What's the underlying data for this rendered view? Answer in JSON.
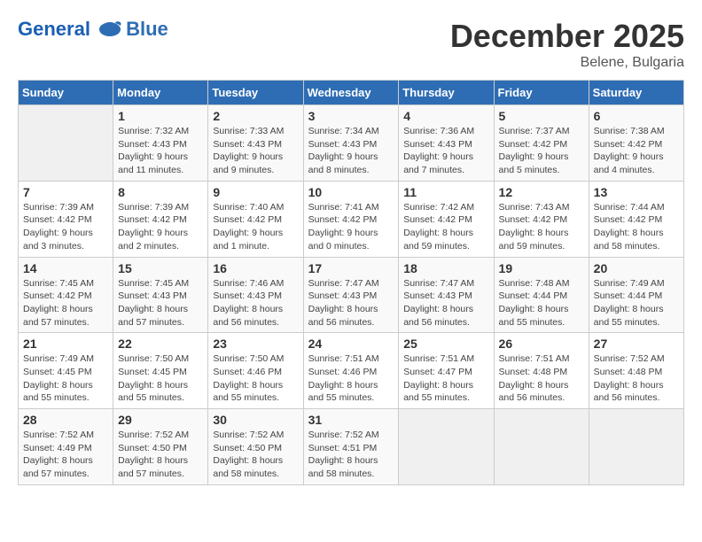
{
  "logo": {
    "line1": "General",
    "line2": "Blue"
  },
  "title": "December 2025",
  "location": "Belene, Bulgaria",
  "days_of_week": [
    "Sunday",
    "Monday",
    "Tuesday",
    "Wednesday",
    "Thursday",
    "Friday",
    "Saturday"
  ],
  "weeks": [
    [
      {
        "day": "",
        "info": ""
      },
      {
        "day": "1",
        "info": "Sunrise: 7:32 AM\nSunset: 4:43 PM\nDaylight: 9 hours\nand 11 minutes."
      },
      {
        "day": "2",
        "info": "Sunrise: 7:33 AM\nSunset: 4:43 PM\nDaylight: 9 hours\nand 9 minutes."
      },
      {
        "day": "3",
        "info": "Sunrise: 7:34 AM\nSunset: 4:43 PM\nDaylight: 9 hours\nand 8 minutes."
      },
      {
        "day": "4",
        "info": "Sunrise: 7:36 AM\nSunset: 4:43 PM\nDaylight: 9 hours\nand 7 minutes."
      },
      {
        "day": "5",
        "info": "Sunrise: 7:37 AM\nSunset: 4:42 PM\nDaylight: 9 hours\nand 5 minutes."
      },
      {
        "day": "6",
        "info": "Sunrise: 7:38 AM\nSunset: 4:42 PM\nDaylight: 9 hours\nand 4 minutes."
      }
    ],
    [
      {
        "day": "7",
        "info": "Sunrise: 7:39 AM\nSunset: 4:42 PM\nDaylight: 9 hours\nand 3 minutes."
      },
      {
        "day": "8",
        "info": "Sunrise: 7:39 AM\nSunset: 4:42 PM\nDaylight: 9 hours\nand 2 minutes."
      },
      {
        "day": "9",
        "info": "Sunrise: 7:40 AM\nSunset: 4:42 PM\nDaylight: 9 hours\nand 1 minute."
      },
      {
        "day": "10",
        "info": "Sunrise: 7:41 AM\nSunset: 4:42 PM\nDaylight: 9 hours\nand 0 minutes."
      },
      {
        "day": "11",
        "info": "Sunrise: 7:42 AM\nSunset: 4:42 PM\nDaylight: 8 hours\nand 59 minutes."
      },
      {
        "day": "12",
        "info": "Sunrise: 7:43 AM\nSunset: 4:42 PM\nDaylight: 8 hours\nand 59 minutes."
      },
      {
        "day": "13",
        "info": "Sunrise: 7:44 AM\nSunset: 4:42 PM\nDaylight: 8 hours\nand 58 minutes."
      }
    ],
    [
      {
        "day": "14",
        "info": "Sunrise: 7:45 AM\nSunset: 4:42 PM\nDaylight: 8 hours\nand 57 minutes."
      },
      {
        "day": "15",
        "info": "Sunrise: 7:45 AM\nSunset: 4:43 PM\nDaylight: 8 hours\nand 57 minutes."
      },
      {
        "day": "16",
        "info": "Sunrise: 7:46 AM\nSunset: 4:43 PM\nDaylight: 8 hours\nand 56 minutes."
      },
      {
        "day": "17",
        "info": "Sunrise: 7:47 AM\nSunset: 4:43 PM\nDaylight: 8 hours\nand 56 minutes."
      },
      {
        "day": "18",
        "info": "Sunrise: 7:47 AM\nSunset: 4:43 PM\nDaylight: 8 hours\nand 56 minutes."
      },
      {
        "day": "19",
        "info": "Sunrise: 7:48 AM\nSunset: 4:44 PM\nDaylight: 8 hours\nand 55 minutes."
      },
      {
        "day": "20",
        "info": "Sunrise: 7:49 AM\nSunset: 4:44 PM\nDaylight: 8 hours\nand 55 minutes."
      }
    ],
    [
      {
        "day": "21",
        "info": "Sunrise: 7:49 AM\nSunset: 4:45 PM\nDaylight: 8 hours\nand 55 minutes."
      },
      {
        "day": "22",
        "info": "Sunrise: 7:50 AM\nSunset: 4:45 PM\nDaylight: 8 hours\nand 55 minutes."
      },
      {
        "day": "23",
        "info": "Sunrise: 7:50 AM\nSunset: 4:46 PM\nDaylight: 8 hours\nand 55 minutes."
      },
      {
        "day": "24",
        "info": "Sunrise: 7:51 AM\nSunset: 4:46 PM\nDaylight: 8 hours\nand 55 minutes."
      },
      {
        "day": "25",
        "info": "Sunrise: 7:51 AM\nSunset: 4:47 PM\nDaylight: 8 hours\nand 55 minutes."
      },
      {
        "day": "26",
        "info": "Sunrise: 7:51 AM\nSunset: 4:48 PM\nDaylight: 8 hours\nand 56 minutes."
      },
      {
        "day": "27",
        "info": "Sunrise: 7:52 AM\nSunset: 4:48 PM\nDaylight: 8 hours\nand 56 minutes."
      }
    ],
    [
      {
        "day": "28",
        "info": "Sunrise: 7:52 AM\nSunset: 4:49 PM\nDaylight: 8 hours\nand 57 minutes."
      },
      {
        "day": "29",
        "info": "Sunrise: 7:52 AM\nSunset: 4:50 PM\nDaylight: 8 hours\nand 57 minutes."
      },
      {
        "day": "30",
        "info": "Sunrise: 7:52 AM\nSunset: 4:50 PM\nDaylight: 8 hours\nand 58 minutes."
      },
      {
        "day": "31",
        "info": "Sunrise: 7:52 AM\nSunset: 4:51 PM\nDaylight: 8 hours\nand 58 minutes."
      },
      {
        "day": "",
        "info": ""
      },
      {
        "day": "",
        "info": ""
      },
      {
        "day": "",
        "info": ""
      }
    ]
  ]
}
